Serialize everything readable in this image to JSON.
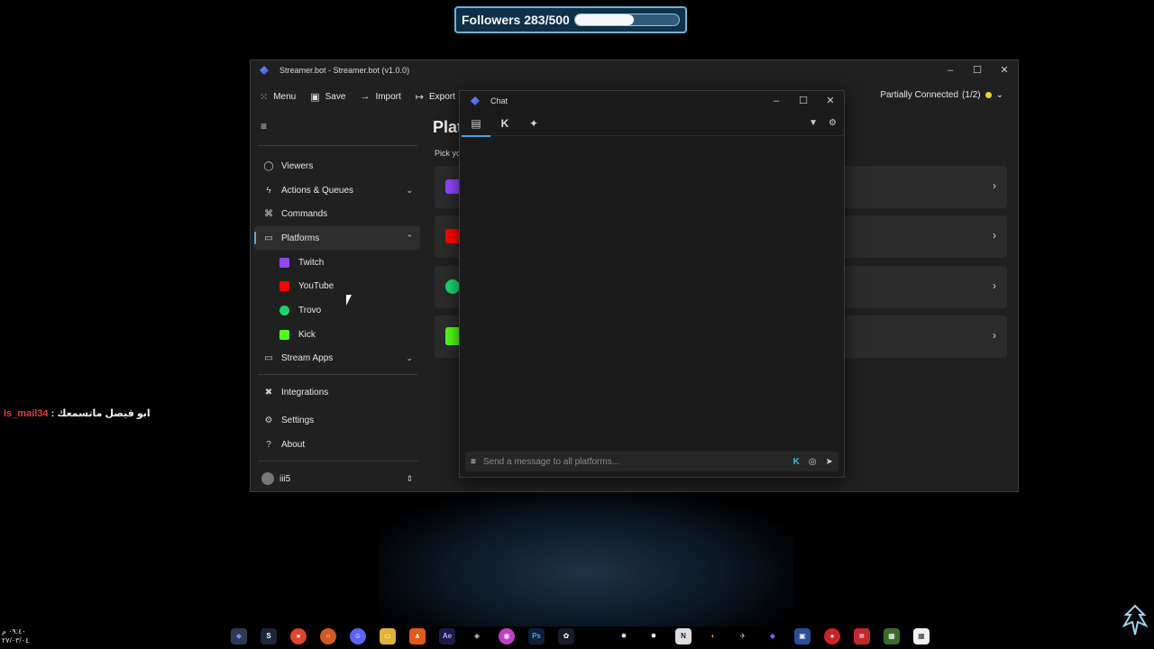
{
  "overlay": {
    "followers_label": "Followers 283/500",
    "followers_current": 283,
    "followers_goal": 500
  },
  "desktop_chat": {
    "user": "Is_mail34",
    "separator": " : ",
    "message": "ابو فيصل ماتسمعك"
  },
  "main_window": {
    "title": "Streamer.bot - Streamer.bot (v1.0.0)",
    "toolbar": {
      "menu": "Menu",
      "save": "Save",
      "import": "Import",
      "export": "Export"
    },
    "connection": {
      "label": "Partially Connected",
      "count": "(1/2)",
      "status_color": "#f2d21b"
    },
    "sidebar": {
      "items": [
        {
          "label": "Viewers",
          "icon": "person-icon"
        },
        {
          "label": "Actions & Queues",
          "icon": "lightning-icon"
        },
        {
          "label": "Commands",
          "icon": "command-icon"
        },
        {
          "label": "Platforms",
          "icon": "platforms-icon"
        },
        {
          "label": "Twitch",
          "icon": "twitch-icon"
        },
        {
          "label": "YouTube",
          "icon": "youtube-icon"
        },
        {
          "label": "Trovo",
          "icon": "trovo-icon"
        },
        {
          "label": "Kick",
          "icon": "kick-icon"
        },
        {
          "label": "Stream Apps",
          "icon": "camera-icon"
        },
        {
          "label": "Integrations",
          "icon": "tools-icon"
        },
        {
          "label": "Settings",
          "icon": "gear-icon"
        },
        {
          "label": "About",
          "icon": "question-icon"
        }
      ],
      "profile_name": "iii5"
    },
    "content": {
      "title": "Platforms",
      "subtitle": "Pick your platform"
    }
  },
  "chat_window": {
    "title": "Chat",
    "input_placeholder": "Send a message to all platforms..."
  },
  "clock": {
    "time": "٠٩:٤٠ م",
    "date": "٢٧/٠٣/٠٤"
  },
  "colors": {
    "twitch": "#9146ff",
    "youtube": "#ff0000",
    "trovo": "#19d66b",
    "kick": "#53fc18",
    "accent": "#60a8e0"
  }
}
